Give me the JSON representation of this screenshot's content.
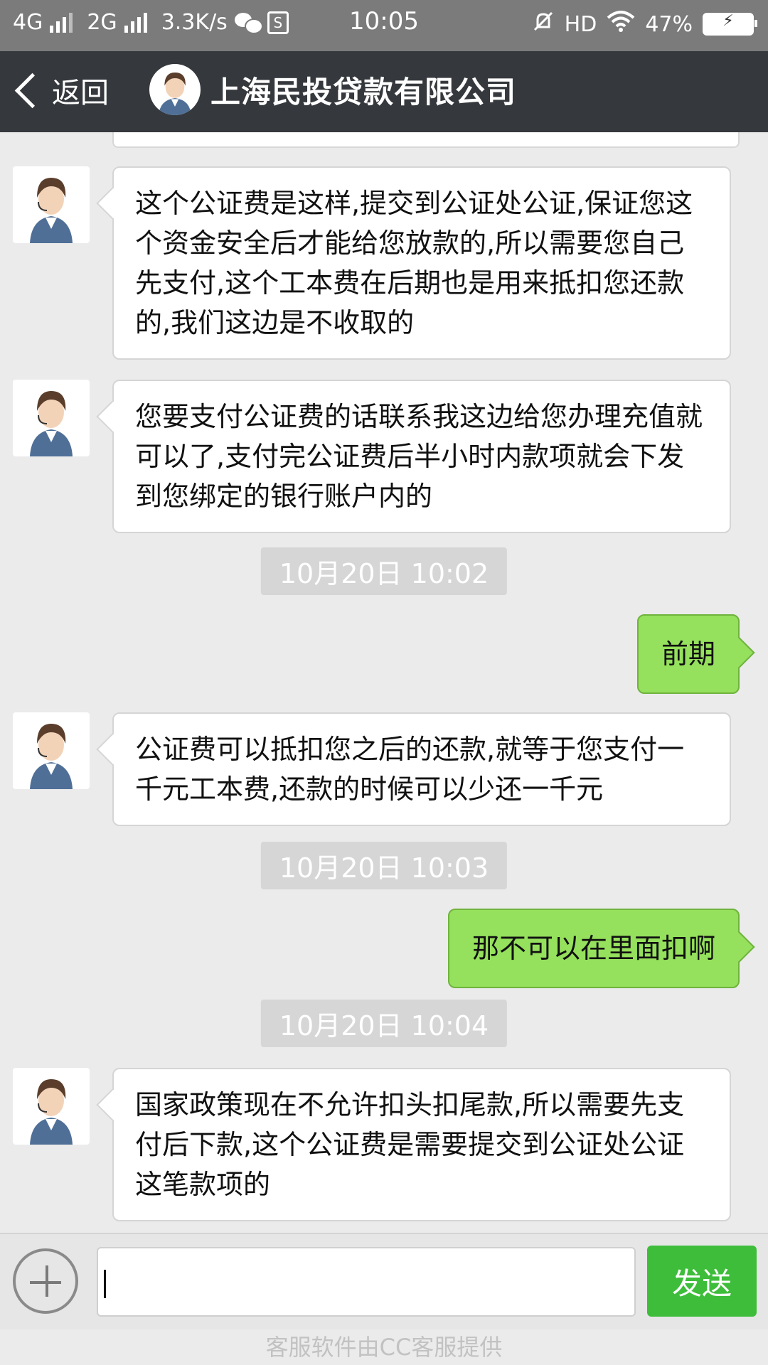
{
  "status_bar": {
    "net1": "4G",
    "net2": "2G",
    "speed": "3.3K/s",
    "time": "10:05",
    "hd": "HD",
    "battery": "47%"
  },
  "header": {
    "back_label": "返回",
    "title": "上海民投贷款有限公司"
  },
  "messages": {
    "m1": "这个公证费是这样,提交到公证处公证,保证您这个资金安全后才能给您放款的,所以需要您自己先支付,这个工本费在后期也是用来抵扣您还款的,我们这边是不收取的",
    "m2": "您要支付公证费的话联系我这边给您办理充值就可以了,支付完公证费后半小时内款项就会下发到您绑定的银行账户内的",
    "ts1": "10月20日 10:02",
    "m3": "前期",
    "m4": "公证费可以抵扣您之后的还款,就等于您支付一千元工本费,还款的时候可以少还一千元",
    "ts2": "10月20日 10:03",
    "m5": "那不可以在里面扣啊",
    "ts3": "10月20日 10:04",
    "m6": "国家政策现在不允许扣头扣尾款,所以需要先支付后下款,这个公证费是需要提交到公证处公证这笔款项的"
  },
  "input": {
    "send_label": "发送",
    "value": ""
  },
  "footer": {
    "text": "客服软件由CC客服提供"
  },
  "colors": {
    "header_bg": "#35383c",
    "status_bg": "#7b7b7b",
    "sent_bubble": "#95e05c",
    "send_button": "#3ebd3b"
  }
}
